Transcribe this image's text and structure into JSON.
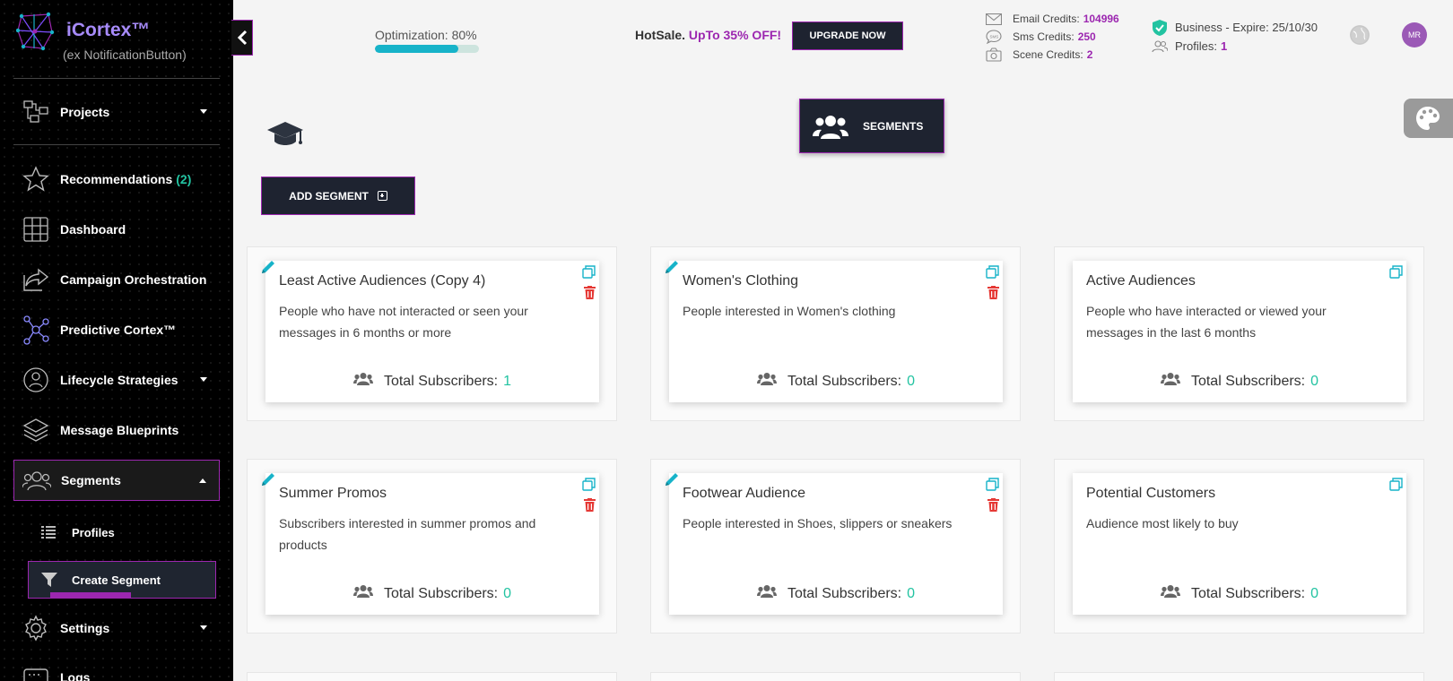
{
  "brand": {
    "name": "iCortex™",
    "subtitle": "(ex NotificationButton)"
  },
  "sidebar": {
    "items": [
      {
        "label": "Projects",
        "icon": "projects-icon"
      },
      {
        "label": "Recommendations",
        "count": "(2)",
        "icon": "star-icon"
      },
      {
        "label": "Dashboard",
        "icon": "grid-icon"
      },
      {
        "label": "Campaign Orchestration",
        "icon": "share-icon"
      },
      {
        "label": "Predictive Cortex™",
        "icon": "network-icon"
      },
      {
        "label": "Lifecycle Strategies",
        "icon": "lifecycle-icon"
      },
      {
        "label": "Message Blueprints",
        "icon": "layers-icon"
      },
      {
        "label": "Segments",
        "icon": "users-icon"
      },
      {
        "label": "Settings",
        "icon": "gear-icon"
      },
      {
        "label": "Logs",
        "icon": "logs-icon"
      }
    ],
    "sub_items": [
      {
        "label": "Profiles",
        "icon": "list-icon"
      },
      {
        "label": "Create Segment",
        "icon": "filter-icon"
      }
    ]
  },
  "header": {
    "optimization_label": "Optimization: 80%",
    "optimization_value": 0.8,
    "promo_prefix": "HotSale.",
    "promo_highlight": "UpTo 35% OFF!",
    "upgrade_label": "UPGRADE NOW",
    "credits": [
      {
        "label": "Email Credits:",
        "value": "104996",
        "icon": "mail-icon"
      },
      {
        "label": "Sms Credits:",
        "value": "250",
        "icon": "sms-icon"
      },
      {
        "label": "Scene Credits:",
        "value": "2",
        "icon": "scene-icon"
      }
    ],
    "plan": "Business - Expire: 25/10/30",
    "profiles_label": "Profiles:",
    "profiles_value": "1",
    "avatar_initials": "MR"
  },
  "page": {
    "segments_title": "SEGMENTS",
    "add_segment_label": "ADD SEGMENT"
  },
  "colors": {
    "accent": "#9c27b0",
    "teal": "#22c3a1",
    "dark": "#1e2330",
    "danger": "#e53935",
    "copy": "#17b3c9"
  },
  "cards": [
    {
      "title": "Least Active Audiences (Copy 4)",
      "description": "People who have not interacted or seen your messages in 6 months or more",
      "total_label": "Total Subscribers:",
      "total": "1"
    },
    {
      "title": "Women's Clothing",
      "description": "People interested in Women's clothing",
      "total_label": "Total Subscribers:",
      "total": "0"
    },
    {
      "title": "Active Audiences",
      "description": "People who have interacted or viewed your messages in the last 6 months",
      "total_label": "Total Subscribers:",
      "total": "0"
    },
    {
      "title": "Summer Promos",
      "description": "Subscribers interested in summer promos and products",
      "total_label": "Total Subscribers:",
      "total": "0"
    },
    {
      "title": "Footwear Audience",
      "description": "People interested in Shoes, slippers or sneakers",
      "total_label": "Total Subscribers:",
      "total": "0"
    },
    {
      "title": "Potential Customers",
      "description": "Audience most likely to buy",
      "total_label": "Total Subscribers:",
      "total": "0"
    }
  ]
}
